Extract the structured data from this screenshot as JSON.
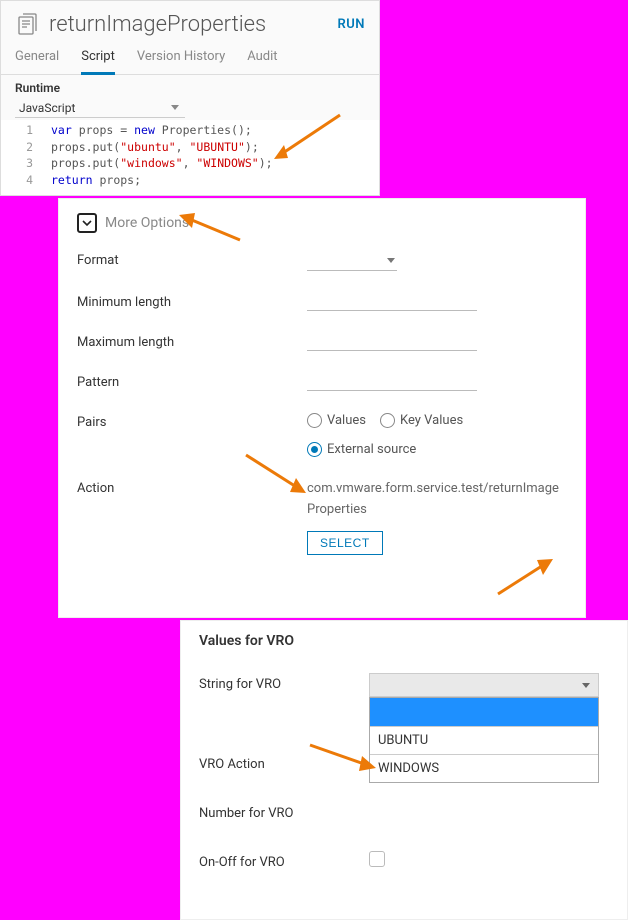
{
  "panel1": {
    "title": "returnImageProperties",
    "run_label": "RUN",
    "tabs": [
      "General",
      "Script",
      "Version History",
      "Audit"
    ],
    "active_tab": "Script",
    "runtime_label": "Runtime",
    "runtime_value": "JavaScript",
    "code_lines": [
      {
        "n": "1",
        "html": "<span class='kw'>var</span> props = <span class='kw'>new</span> Properties();"
      },
      {
        "n": "2",
        "html": "props.put(<span class='str'>\"ubuntu\"</span>, <span class='str'>\"UBUNTU\"</span>);"
      },
      {
        "n": "3",
        "html": "props.put(<span class='str'>\"windows\"</span>, <span class='str'>\"WINDOWS\"</span>);"
      },
      {
        "n": "4",
        "html": "<span class='kw'>return</span> props;"
      }
    ]
  },
  "panel2": {
    "more_options": "More Options",
    "format_label": "Format",
    "min_length_label": "Minimum length",
    "max_length_label": "Maximum length",
    "pattern_label": "Pattern",
    "pairs_label": "Pairs",
    "pairs_options": {
      "values": "Values",
      "keyvalues": "Key Values",
      "external": "External source"
    },
    "pairs_selected": "external",
    "action_label": "Action",
    "action_value": "com.vmware.form.service.test/returnImageProperties",
    "select_btn": "SELECT"
  },
  "panel3": {
    "title": "Values for VRO",
    "string_label": "String for VRO",
    "vro_action_label": "VRO Action",
    "number_label": "Number for VRO",
    "onoff_label": "On-Off for VRO",
    "dropdown_items": [
      "UBUNTU",
      "WINDOWS"
    ]
  }
}
